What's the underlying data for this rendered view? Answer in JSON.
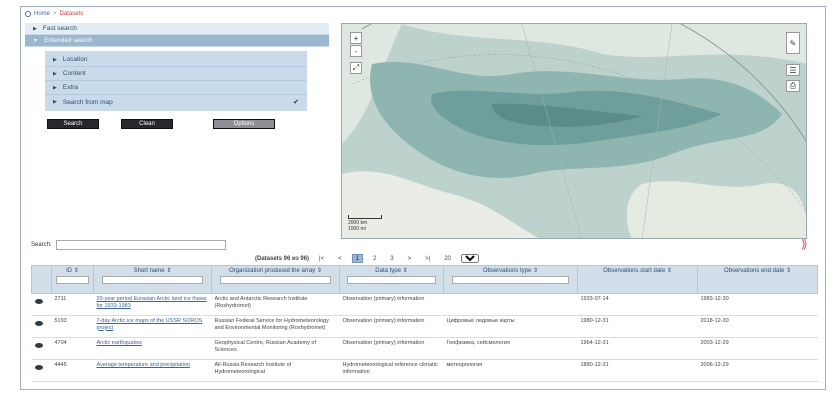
{
  "breadcrumb": {
    "home": "Home",
    "separator": ">",
    "current": "Datasets"
  },
  "accordion": {
    "fast_search": "Fast search",
    "extended_search": "Extended search"
  },
  "subsections": [
    "Location",
    "Content",
    "Extra",
    "Search from map"
  ],
  "buttons": {
    "search": "Search",
    "clean": "Clean",
    "options": "Options"
  },
  "map": {
    "zoom_in": "+",
    "zoom_out": "-",
    "scale_top": "2000 km",
    "scale_bottom": "1000 mi"
  },
  "search": {
    "label": "Search:",
    "value": ""
  },
  "pager": {
    "info": "(Datasets 96 из 96)",
    "first": "|<",
    "prev": "<",
    "pages": [
      "1",
      "2",
      "3"
    ],
    "active_page": "1",
    "next": ">",
    "last": ">|",
    "page_size": "20"
  },
  "table": {
    "columns": [
      "",
      "ID",
      "Short name",
      "Organization produced the array",
      "Data type",
      "Observations type",
      "Observations start date",
      "Observations end date"
    ],
    "rows": [
      {
        "id": "2711",
        "name": "20-year period Eurasian Arctic land ice thaws for 1933-1983",
        "org": "Arctic and Antarctic Research Institute (Roshydromet)",
        "dtype": "Observation (primary) information",
        "otype": "",
        "start": "1933-07-14",
        "end": "1983-12-30"
      },
      {
        "id": "5193",
        "name": "7-day Arctic ice maps of the USSR SOROS project",
        "org": "Russian Federal Service for Hydrometeorology and Environmental Monitoring (Roshydromet)",
        "dtype": "Observation (primary) information",
        "otype": "Цифровые ледовые карты",
        "start": "1980-12-31",
        "end": "2018-12-30"
      },
      {
        "id": "4704",
        "name": "Arctic earthquakes",
        "org": "Geophysical Centre, Russian Academy of Sciences",
        "dtype": "Observation (primary) information",
        "otype": "Геофизика, сейсмология",
        "start": "1964-12-31",
        "end": "2003-12-29"
      },
      {
        "id": "4445",
        "name": "Average temperature and precipitation",
        "org": "All-Russia Research Institute of Hydrometeorological",
        "dtype": "Hydrometeorological reference climatic information",
        "otype": "метеорология",
        "start": "1880-12-31",
        "end": "2006-12-29"
      }
    ]
  }
}
